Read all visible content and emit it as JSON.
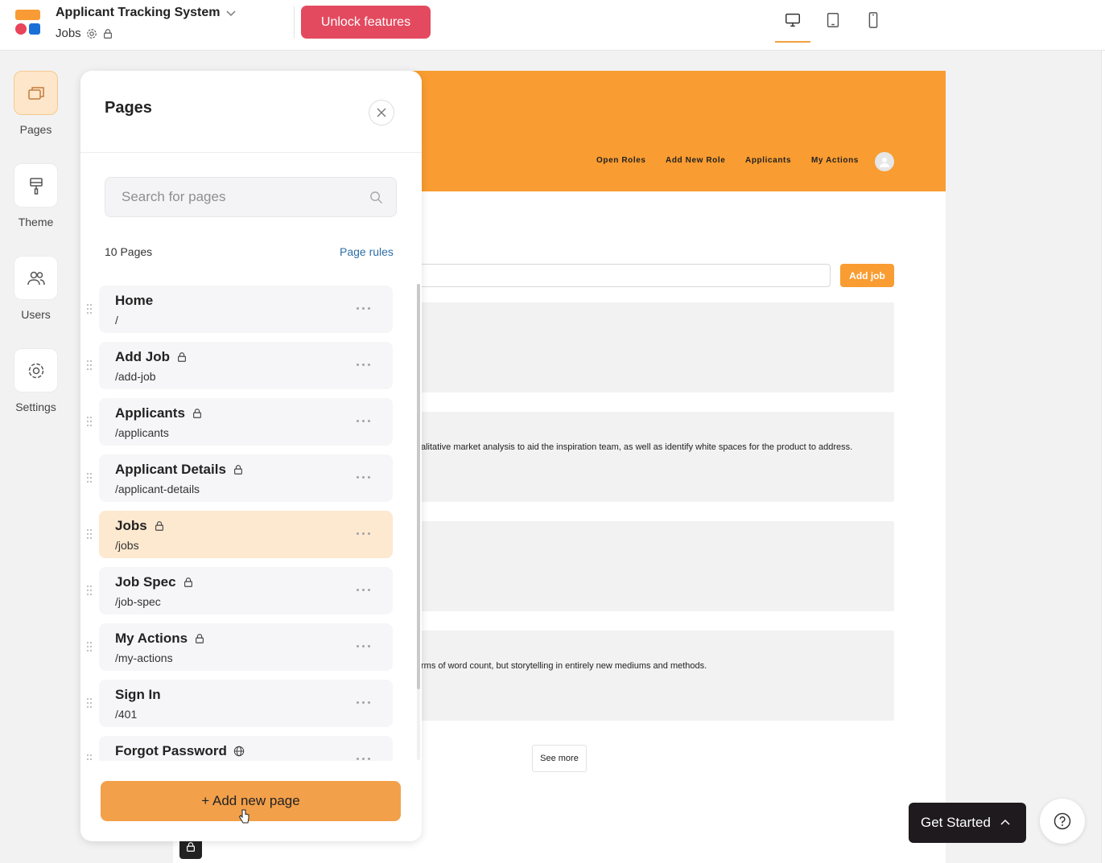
{
  "app": {
    "title": "Applicant Tracking System",
    "current_page": "Jobs",
    "unlock_label": "Unlock features"
  },
  "colors": {
    "brand_orange": "#f99c31",
    "unlock_red": "#e34a5f",
    "active_row": "#fde9d0",
    "link_blue": "#2c6ea6"
  },
  "devices": [
    {
      "icon": "desktop-icon",
      "active": true
    },
    {
      "icon": "tablet-icon",
      "active": false
    },
    {
      "icon": "mobile-icon",
      "active": false
    }
  ],
  "rail": [
    {
      "label": "Pages",
      "icon": "pages-icon",
      "active": true
    },
    {
      "label": "Theme",
      "icon": "paint-roller-icon",
      "active": false
    },
    {
      "label": "Users",
      "icon": "users-icon",
      "active": false
    },
    {
      "label": "Settings",
      "icon": "gear-icon",
      "active": false
    }
  ],
  "panel": {
    "title": "Pages",
    "search_placeholder": "Search for pages",
    "count": "10 Pages",
    "page_rules": "Page rules",
    "add_label": "+ Add new page",
    "pages": [
      {
        "name": "Home",
        "path": "/",
        "icon": ""
      },
      {
        "name": "Add Job",
        "path": "/add-job",
        "icon": "lock-icon"
      },
      {
        "name": "Applicants",
        "path": "/applicants",
        "icon": "lock-icon"
      },
      {
        "name": "Applicant Details",
        "path": "/applicant-details",
        "icon": "lock-icon"
      },
      {
        "name": "Jobs",
        "path": "/jobs",
        "icon": "lock-icon",
        "active": true
      },
      {
        "name": "Job Spec",
        "path": "/job-spec",
        "icon": "lock-icon"
      },
      {
        "name": "My Actions",
        "path": "/my-actions",
        "icon": "lock-icon"
      },
      {
        "name": "Sign In",
        "path": "/401",
        "icon": ""
      },
      {
        "name": "Forgot Password",
        "path": "",
        "icon": "globe-icon"
      }
    ]
  },
  "preview": {
    "nav": [
      "Open Roles",
      "Add New Role",
      "Applicants",
      "My Actions"
    ],
    "add_job": "Add job",
    "card_texts": [
      "",
      "alitative market analysis to aid the inspiration team, as well as identify white spaces for the product to address.",
      "",
      "rms of word count, but storytelling in entirely new mediums and methods."
    ],
    "see_more": "See more"
  },
  "footer": {
    "get_started": "Get Started"
  }
}
